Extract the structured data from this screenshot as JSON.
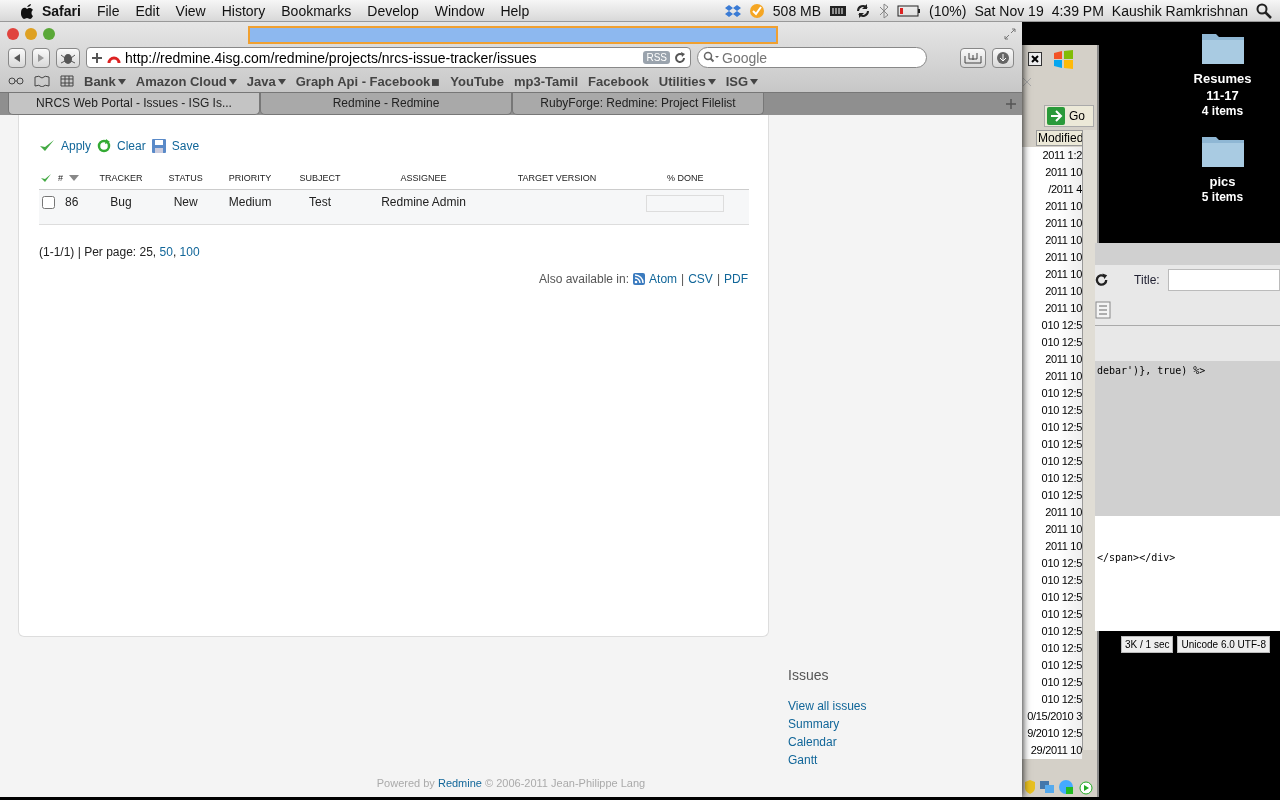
{
  "menubar": {
    "app": "Safari",
    "menus": [
      "File",
      "Edit",
      "View",
      "History",
      "Bookmarks",
      "Develop",
      "Window",
      "Help"
    ],
    "memory": "508 MB",
    "battery": "(10%)",
    "date": "Sat Nov 19",
    "time": "4:39 PM",
    "user": "Kaushik Ramkrishnan"
  },
  "desktop_icons": [
    {
      "name": "Resumes 11-17",
      "info": "4 items"
    },
    {
      "name": "pics",
      "info": "5 items"
    }
  ],
  "explorer": {
    "go": "Go",
    "column": "Modified",
    "dates": [
      "2011 1:2",
      "2011 10",
      "/2011 4",
      "2011 10",
      "2011 10",
      "2011 10",
      "2011 10",
      "2011 10",
      "2011 10",
      "2011 10",
      "010 12:5",
      "010 12:5",
      "2011 10",
      "2011 10",
      "010 12:5",
      "010 12:5",
      "010 12:5",
      "010 12:5",
      "010 12:5",
      "010 12:5",
      "010 12:5",
      "2011 10",
      "2011 10",
      "2011 10",
      "010 12:5",
      "010 12:5",
      "010 12:5",
      "010 12:5",
      "010 12:5",
      "010 12:5",
      "010 12:5",
      "010 12:5",
      "010 12:5",
      "0/15/2010 3",
      "9/2010 12:5",
      "29/2011 10"
    ]
  },
  "editor": {
    "title_label": "Title:",
    "code_lines": [
      {
        "text": "debar')}, true) %>",
        "highlighted": true
      },
      {
        "text": "</span></div>",
        "highlighted": false
      }
    ],
    "status": [
      "3K / 1 sec",
      "Unicode 6.0 UTF-8"
    ]
  },
  "browser": {
    "url": "http://redmine.4isg.com/redmine/projects/nrcs-issue-tracker/issues",
    "rss": "RSS",
    "search_placeholder": "Google",
    "bookmarks": [
      {
        "label": "Bank",
        "kind": "menu"
      },
      {
        "label": "Amazon Cloud",
        "kind": "menu"
      },
      {
        "label": "Java",
        "kind": "menu"
      },
      {
        "label": "Graph Api - Facebook",
        "kind": "collection"
      },
      {
        "label": "YouTube",
        "kind": "link"
      },
      {
        "label": "mp3-Tamil",
        "kind": "link"
      },
      {
        "label": "Facebook",
        "kind": "link"
      },
      {
        "label": "Utilities",
        "kind": "menu"
      },
      {
        "label": "ISG",
        "kind": "menu"
      }
    ],
    "tabs": [
      {
        "title": "NRCS Web Portal - Issues - ISG Is...",
        "selected": true
      },
      {
        "title": "Redmine - Redmine",
        "selected": false
      },
      {
        "title": "RubyForge: Redmine: Project Filelist",
        "selected": false
      }
    ]
  },
  "page": {
    "actions": [
      {
        "label": "Apply",
        "kind": "apply"
      },
      {
        "label": "Clear",
        "kind": "clear"
      },
      {
        "label": "Save",
        "kind": "save"
      }
    ],
    "columns": [
      "#",
      "TRACKER",
      "STATUS",
      "PRIORITY",
      "SUBJECT",
      "ASSIGNEE",
      "TARGET VERSION",
      "% DONE"
    ],
    "rows": [
      {
        "checked": false,
        "cells": [
          "86",
          "Bug",
          "New",
          "Medium",
          "Test",
          "Redmine Admin",
          ""
        ],
        "level": 0
      }
    ],
    "pagination": {
      "text": "(1-1/1) | Per page: 25,",
      "links": [
        "50",
        "100"
      ],
      "separator": ","
    },
    "export": {
      "label": "Also available in:",
      "formats": [
        "Atom",
        "CSV",
        "PDF"
      ],
      "separator": "|"
    },
    "sidebar": {
      "title": "Issues",
      "links": [
        "View all issues",
        "Summary",
        "Calendar",
        "Gantt"
      ]
    },
    "footer": {
      "prefix": "Powered by",
      "link": "Redmine",
      "suffix": "© 2006-2011 Jean-Philippe Lang"
    }
  }
}
